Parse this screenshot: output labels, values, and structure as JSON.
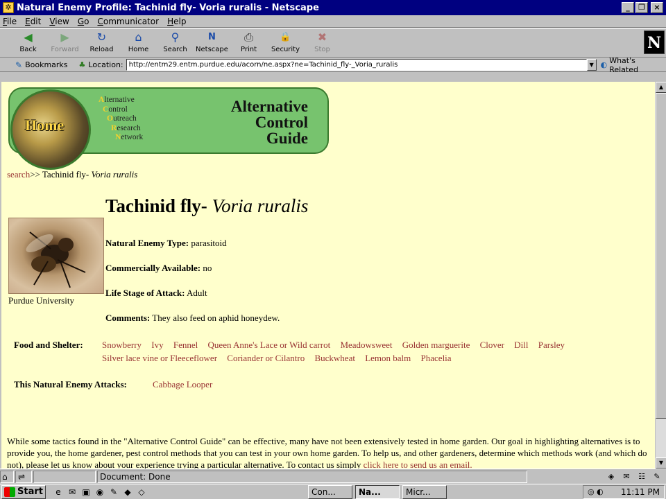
{
  "window": {
    "title": "Natural Enemy Profile: Tachinid fly- Voria ruralis - Netscape",
    "minimize_glyph": "_",
    "maximize_glyph": "❐",
    "close_glyph": "×"
  },
  "menu": [
    "File",
    "Edit",
    "View",
    "Go",
    "Communicator",
    "Help"
  ],
  "toolbar": [
    {
      "label": "Back",
      "icon": "◀"
    },
    {
      "label": "Forward",
      "icon": "▶"
    },
    {
      "label": "Reload",
      "icon": "↻"
    },
    {
      "label": "Home",
      "icon": "⌂"
    },
    {
      "label": "Search",
      "icon": "⚲"
    },
    {
      "label": "Netscape",
      "icon": "N"
    },
    {
      "label": "Print",
      "icon": "⎙"
    },
    {
      "label": "Security",
      "icon": "🔒"
    },
    {
      "label": "Stop",
      "icon": "✖"
    }
  ],
  "ns_logo": "N",
  "location": {
    "bookmarks_label": "Bookmarks",
    "location_label": "Location:",
    "url": "http://entm29.entm.purdue.edu/acorn/ne.aspx?ne=Tachinid_fly-_Voria_ruralis",
    "whats_related": "What's Related"
  },
  "banner": {
    "home_label": "Home",
    "acorn": [
      {
        "initial": "A",
        "rest": "lternative"
      },
      {
        "initial": "C",
        "rest": "ontrol"
      },
      {
        "initial": "O",
        "rest": "utreach"
      },
      {
        "initial": "R",
        "rest": "esearch"
      },
      {
        "initial": "N",
        "rest": "etwork"
      }
    ],
    "title_lines": [
      "Alternative",
      "Control",
      "Guide"
    ]
  },
  "breadcrumb": {
    "link": "search",
    "sep": ">> ",
    "common": "Tachinid fly- ",
    "sci": "Voria ruralis"
  },
  "heading": {
    "common": "Tachinid fly- ",
    "sci": "Voria ruralis"
  },
  "photo_credit": "Purdue University",
  "fields": [
    {
      "label": "Natural Enemy Type:",
      "value": " parasitoid"
    },
    {
      "label": "Commercially Available:",
      "value": " no"
    },
    {
      "label": "Life Stage of Attack:",
      "value": " Adult"
    },
    {
      "label": "Comments:",
      "value": " They also feed on aphid honeydew."
    }
  ],
  "food_shelter": {
    "label": "Food and Shelter:",
    "row1": [
      "Snowberry",
      "Ivy",
      "Fennel",
      "Queen Anne's Lace or Wild carrot",
      "Meadowsweet",
      "Golden marguerite",
      "Clover",
      "Dill",
      "Parsley"
    ],
    "row2": [
      "Silver lace vine or Fleeceflower",
      "Coriander or Cilantro",
      "Buckwheat",
      "Lemon balm",
      "Phacelia"
    ]
  },
  "attacks": {
    "label": "This Natural Enemy Attacks:",
    "link": "Cabbage Looper"
  },
  "paragraph": {
    "text": "While some tactics found in the \"Alternative Control Guide\" can be effective, many have not been extensively tested in home garden. Our goal in highlighting alternatives is to provide you, the home gardener, pest control methods that you can test in your own home garden. To help us, and other gardeners, determine which methods work (and which do not), please let us know about your experience trying a particular alternative. To contact us simply ",
    "link": "click here to send us an email."
  },
  "status": {
    "text": "Document: Done"
  },
  "taskbar": {
    "start": "Start",
    "tasks": [
      "Con...",
      "Na...",
      "Micr..."
    ],
    "clock": "11:11 PM"
  }
}
